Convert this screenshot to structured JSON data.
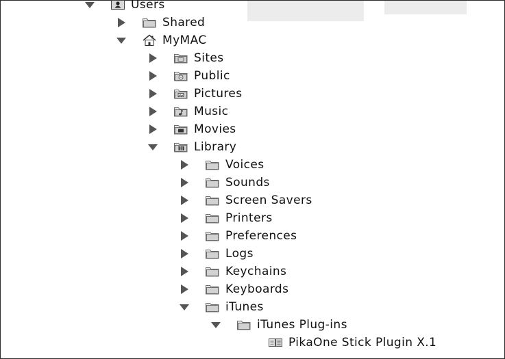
{
  "tree": {
    "items": [
      {
        "label": "Users",
        "depth": 0,
        "expanded": true,
        "icon": "users-folder-icon"
      },
      {
        "label": "Shared",
        "depth": 1,
        "expanded": false,
        "icon": "folder-icon"
      },
      {
        "label": "MyMAC",
        "depth": 1,
        "expanded": true,
        "icon": "home-icon"
      },
      {
        "label": "Sites",
        "depth": 2,
        "expanded": false,
        "icon": "sites-folder-icon"
      },
      {
        "label": "Public",
        "depth": 2,
        "expanded": false,
        "icon": "public-folder-icon"
      },
      {
        "label": "Pictures",
        "depth": 2,
        "expanded": false,
        "icon": "pictures-folder-icon"
      },
      {
        "label": "Music",
        "depth": 2,
        "expanded": false,
        "icon": "music-folder-icon"
      },
      {
        "label": "Movies",
        "depth": 2,
        "expanded": false,
        "icon": "movies-folder-icon"
      },
      {
        "label": "Library",
        "depth": 2,
        "expanded": true,
        "icon": "library-folder-icon"
      },
      {
        "label": "Voices",
        "depth": 3,
        "expanded": false,
        "icon": "folder-icon"
      },
      {
        "label": "Sounds",
        "depth": 3,
        "expanded": false,
        "icon": "folder-icon"
      },
      {
        "label": "Screen Savers",
        "depth": 3,
        "expanded": false,
        "icon": "folder-icon"
      },
      {
        "label": "Printers",
        "depth": 3,
        "expanded": false,
        "icon": "folder-icon"
      },
      {
        "label": "Preferences",
        "depth": 3,
        "expanded": false,
        "icon": "folder-icon"
      },
      {
        "label": "Logs",
        "depth": 3,
        "expanded": false,
        "icon": "folder-icon"
      },
      {
        "label": "Keychains",
        "depth": 3,
        "expanded": false,
        "icon": "folder-icon"
      },
      {
        "label": "Keyboards",
        "depth": 3,
        "expanded": false,
        "icon": "folder-icon"
      },
      {
        "label": "iTunes",
        "depth": 3,
        "expanded": true,
        "icon": "folder-icon"
      },
      {
        "label": "iTunes Plug-ins",
        "depth": 4,
        "expanded": true,
        "icon": "folder-icon"
      },
      {
        "label": "PikaOne Stick Plugin X.1",
        "depth": 5,
        "expanded": null,
        "icon": "plugin-bundle-icon"
      }
    ]
  }
}
